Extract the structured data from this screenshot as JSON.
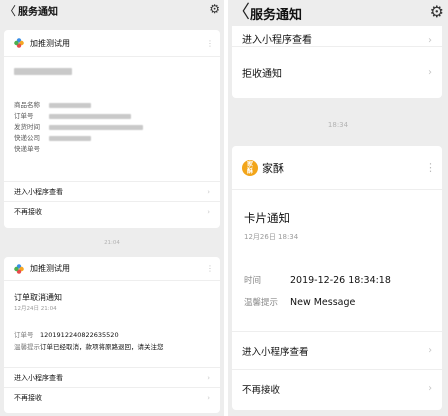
{
  "left": {
    "nav": {
      "back": "〈",
      "title": "服务通知",
      "settings_icon": "gear-icon"
    },
    "card1": {
      "app_name": "加推测试用",
      "more": "⋮",
      "fields": [
        {
          "label": "商品名称"
        },
        {
          "label": "订单号"
        },
        {
          "label": "发货时间"
        },
        {
          "label": "快递公司"
        },
        {
          "label": "快递单号"
        }
      ],
      "menu": [
        {
          "label": "进入小程序查看",
          "chev": "›"
        },
        {
          "label": "不再接收",
          "chev": "›"
        }
      ]
    },
    "time": "21:04",
    "card2": {
      "app_name": "加推测试用",
      "more": "⋮",
      "title": "订单取消通知",
      "date": "12月24日 21:04",
      "fields": [
        {
          "label": "订单号",
          "value": "1201912240822635520"
        },
        {
          "label": "温馨提示",
          "value": "订单已经取消，款项将原路退回，请关注您"
        }
      ],
      "menu": [
        {
          "label": "进入小程序查看",
          "chev": "›"
        },
        {
          "label": "不再接收",
          "chev": "›"
        }
      ]
    }
  },
  "right": {
    "nav": {
      "back": "〈",
      "title": "服务通知",
      "settings_icon": "gear-icon"
    },
    "card1": {
      "menu": [
        {
          "label": "进入小程序查看",
          "chev": "›"
        },
        {
          "label": "拒收通知",
          "chev": "›"
        }
      ]
    },
    "time": "18:34",
    "card2": {
      "brand_logo_top": "家",
      "brand_logo_bottom": "酥",
      "app_name": "家酥",
      "more": "⋮",
      "title": "卡片通知",
      "date": "12月26日 18:34",
      "fields": [
        {
          "label": "时间",
          "value": "2019-12-26 18:34:18"
        },
        {
          "label": "温馨提示",
          "value": "New Message"
        }
      ],
      "menu": [
        {
          "label": "进入小程序查看",
          "chev": "›"
        },
        {
          "label": "不再接收",
          "chev": "›"
        }
      ]
    }
  },
  "colors": {
    "background": "#ededed",
    "card": "#ffffff",
    "brand_orange": "#f2a51a"
  }
}
